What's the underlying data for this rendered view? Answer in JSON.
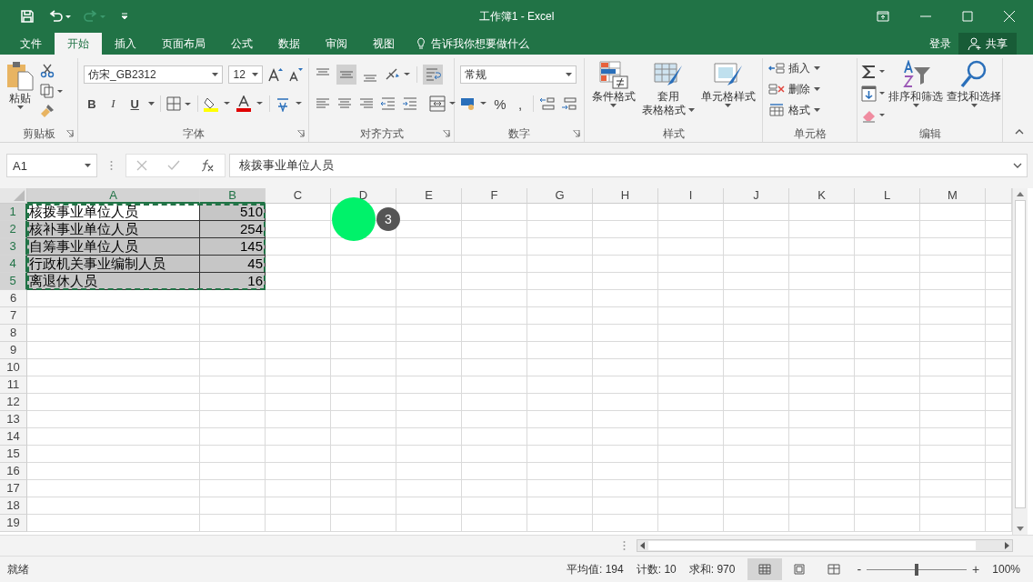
{
  "window": {
    "title": "工作簿1 - Excel"
  },
  "tabs": [
    {
      "label": "文件",
      "selected": false
    },
    {
      "label": "开始",
      "selected": true
    },
    {
      "label": "插入",
      "selected": false
    },
    {
      "label": "页面布局",
      "selected": false
    },
    {
      "label": "公式",
      "selected": false
    },
    {
      "label": "数据",
      "selected": false
    },
    {
      "label": "审阅",
      "selected": false
    },
    {
      "label": "视图",
      "selected": false
    }
  ],
  "tell_me": "告诉我你想要做什么",
  "sign_in": "登录",
  "share": "共享",
  "ribbon": {
    "clipboard": {
      "label": "剪贴板",
      "paste": "粘贴"
    },
    "font": {
      "label": "字体",
      "font_name": "仿宋_GB2312",
      "font_size": "12",
      "bold": "B",
      "italic": "I",
      "underline": "U"
    },
    "alignment": {
      "label": "对齐方式"
    },
    "number": {
      "label": "数字",
      "format": "常规",
      "percent": "%",
      "comma": ","
    },
    "styles": {
      "label": "样式",
      "conditional": "条件格式",
      "table_line1": "套用",
      "table_line2": "表格格式",
      "cell_styles": "单元格样式"
    },
    "cells": {
      "label": "单元格",
      "insert": "插入",
      "delete": "删除",
      "format": "格式"
    },
    "editing": {
      "label": "编辑",
      "sort": "排序和筛选",
      "find": "查找和选择"
    }
  },
  "name_box": "A1",
  "formula": "核拨事业单位人员",
  "columns": [
    {
      "label": "A",
      "selected": true
    },
    {
      "label": "B",
      "selected": true
    },
    {
      "label": "C",
      "selected": false
    },
    {
      "label": "D",
      "selected": false
    },
    {
      "label": "E",
      "selected": false
    },
    {
      "label": "F",
      "selected": false
    },
    {
      "label": "G",
      "selected": false
    },
    {
      "label": "H",
      "selected": false
    },
    {
      "label": "I",
      "selected": false
    },
    {
      "label": "J",
      "selected": false
    },
    {
      "label": "K",
      "selected": false
    },
    {
      "label": "L",
      "selected": false
    },
    {
      "label": "M",
      "selected": false
    }
  ],
  "rows": [
    {
      "number": "1",
      "selected": true,
      "cells": [
        {
          "text": "核拨事业单位人员",
          "kind": "text",
          "selected": true,
          "active": true
        },
        {
          "text": "510",
          "kind": "number",
          "selected": true,
          "active": false
        }
      ]
    },
    {
      "number": "2",
      "selected": true,
      "cells": [
        {
          "text": "核补事业单位人员",
          "kind": "text",
          "selected": true,
          "active": false
        },
        {
          "text": "254",
          "kind": "number",
          "selected": true,
          "active": false
        }
      ]
    },
    {
      "number": "3",
      "selected": true,
      "cells": [
        {
          "text": "自筹事业单位人员",
          "kind": "text",
          "selected": true,
          "active": false
        },
        {
          "text": "145",
          "kind": "number",
          "selected": true,
          "active": false
        }
      ]
    },
    {
      "number": "4",
      "selected": true,
      "cells": [
        {
          "text": "行政机关事业编制人员",
          "kind": "text",
          "selected": true,
          "active": false
        },
        {
          "text": "45",
          "kind": "number",
          "selected": true,
          "active": false
        }
      ]
    },
    {
      "number": "5",
      "selected": true,
      "cells": [
        {
          "text": "离退休人员",
          "kind": "text",
          "selected": true,
          "active": false
        },
        {
          "text": "16",
          "kind": "number",
          "selected": true,
          "active": false
        }
      ]
    },
    {
      "number": "6",
      "selected": false
    },
    {
      "number": "7",
      "selected": false
    },
    {
      "number": "8",
      "selected": false
    },
    {
      "number": "9",
      "selected": false
    },
    {
      "number": "10",
      "selected": false
    },
    {
      "number": "11",
      "selected": false
    },
    {
      "number": "12",
      "selected": false
    },
    {
      "number": "13",
      "selected": false
    },
    {
      "number": "14",
      "selected": false
    },
    {
      "number": "15",
      "selected": false
    },
    {
      "number": "16",
      "selected": false
    },
    {
      "number": "17",
      "selected": false
    },
    {
      "number": "18",
      "selected": false
    },
    {
      "number": "19",
      "selected": false
    }
  ],
  "click_marker": {
    "label": "3"
  },
  "status_bar": {
    "ready": "就绪",
    "average": "平均值: 194",
    "count": "计数: 10",
    "sum": "求和: 970",
    "views": [
      {
        "selected": true
      },
      {
        "selected": false
      },
      {
        "selected": false
      }
    ],
    "zoom_out": "-",
    "zoom_in": "+",
    "zoom": {
      "level": 0.5,
      "reading": "100%"
    }
  }
}
